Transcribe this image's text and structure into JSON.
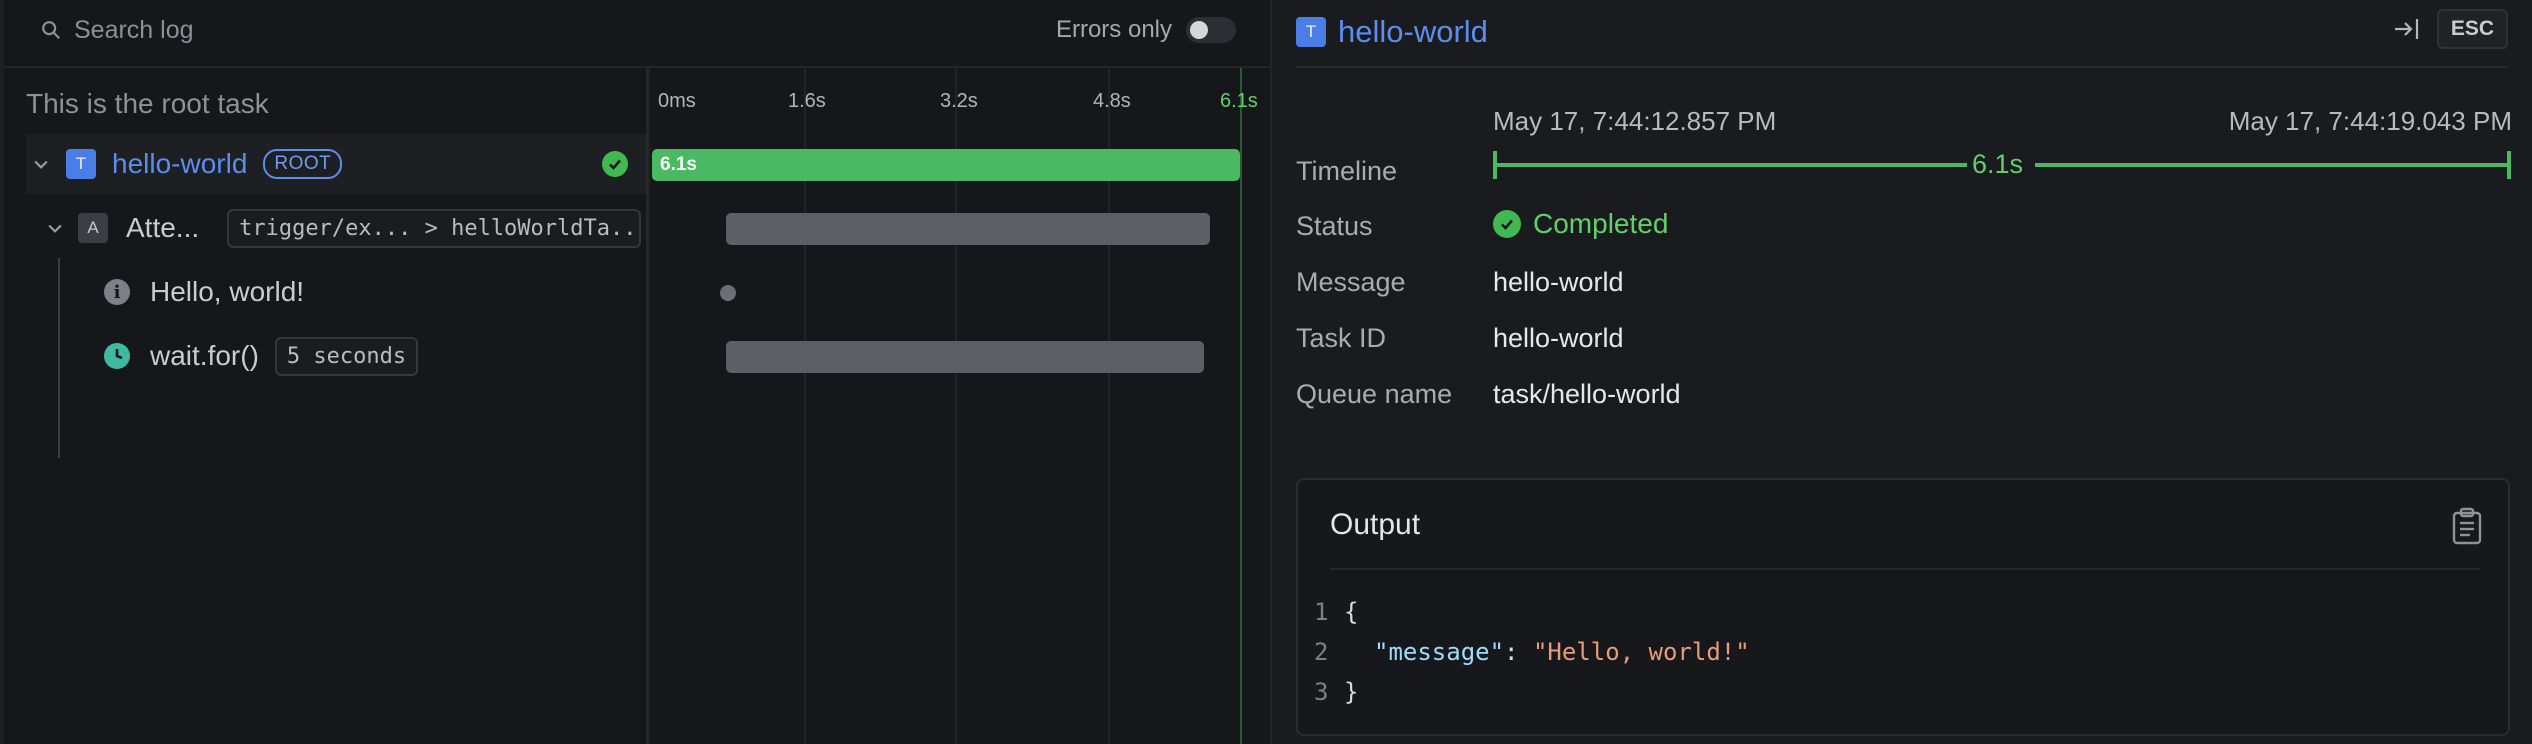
{
  "toolbar": {
    "search_placeholder": "Search log",
    "errors_only_label": "Errors only",
    "errors_only_on": false
  },
  "tree": {
    "root_caption": "This is the root task",
    "rows": {
      "hello_world": {
        "badge": "T",
        "name": "hello-world",
        "pill": "ROOT",
        "status": "completed"
      },
      "attempt": {
        "badge": "A",
        "name": "Atte...",
        "chip": "trigger/ex...  > helloWorldTa..."
      },
      "log": {
        "icon": "info-icon",
        "text": "Hello, world!"
      },
      "wait": {
        "icon": "clock-icon",
        "text": "wait.for()",
        "chip": "5 seconds"
      }
    }
  },
  "timeline": {
    "ticks": [
      "0ms",
      "1.6s",
      "3.2s",
      "4.8s",
      "6.1s"
    ],
    "root_bar_label": "6.1s"
  },
  "inspector": {
    "badge": "T",
    "title": "hello-world",
    "esc_label": "ESC",
    "timeline_label": "Timeline",
    "start_time": "May 17, 7:44:12.857 PM",
    "end_time": "May 17, 7:44:19.043 PM",
    "duration": "6.1s",
    "status_label": "Status",
    "status_value": "Completed",
    "message_label": "Message",
    "message_value": "hello-world",
    "task_id_label": "Task ID",
    "task_id_value": "hello-world",
    "queue_label": "Queue name",
    "queue_value": "task/hello-world",
    "output": {
      "title": "Output",
      "line_numbers": [
        "1",
        "2",
        "3"
      ],
      "open_brace": "{",
      "key": "\"message\"",
      "colon": ": ",
      "value": "\"Hello, world!\"",
      "close_brace": "}"
    }
  },
  "colors": {
    "accent_blue": "#5b8def",
    "success_green": "#4bb863",
    "background": "#15171a"
  }
}
